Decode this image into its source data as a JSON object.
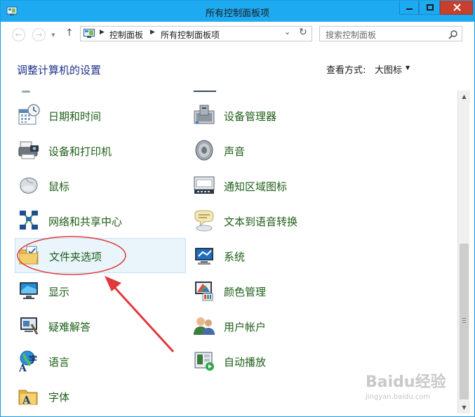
{
  "window": {
    "title": "所有控制面板项"
  },
  "nav": {
    "back_icon": "back-arrow-icon",
    "forward_icon": "forward-arrow-icon",
    "up_icon": "up-arrow-icon",
    "breadcrumbs": [
      "控制面板",
      "所有控制面板项"
    ],
    "search_placeholder": "搜索控制面板"
  },
  "header": {
    "title": "调整计算机的设置",
    "view_by_label": "查看方式:",
    "view_by_value": "大图标"
  },
  "items_left": [
    {
      "label": "日期和时间",
      "icon": "calendar-clock-icon"
    },
    {
      "label": "设备和打印机",
      "icon": "printer-camera-icon"
    },
    {
      "label": "鼠标",
      "icon": "mouse-icon"
    },
    {
      "label": "网络和共享中心",
      "icon": "network-icon"
    },
    {
      "label": "文件夹选项",
      "icon": "folder-options-icon",
      "selected": true
    },
    {
      "label": "显示",
      "icon": "monitor-icon"
    },
    {
      "label": "疑难解答",
      "icon": "troubleshoot-icon"
    },
    {
      "label": "语言",
      "icon": "language-globe-icon"
    },
    {
      "label": "字体",
      "icon": "font-folder-icon"
    }
  ],
  "items_right": [
    {
      "label": "设备管理器",
      "icon": "device-manager-icon"
    },
    {
      "label": "声音",
      "icon": "speaker-icon"
    },
    {
      "label": "通知区域图标",
      "icon": "notification-area-icon"
    },
    {
      "label": "文本到语音转换",
      "icon": "speech-bubble-icon"
    },
    {
      "label": "系统",
      "icon": "system-icon"
    },
    {
      "label": "颜色管理",
      "icon": "color-management-icon"
    },
    {
      "label": "用户帐户",
      "icon": "user-accounts-icon"
    },
    {
      "label": "自动播放",
      "icon": "autoplay-icon"
    }
  ],
  "watermark": {
    "text": "Baidu经验",
    "sub": "jingyan.baidu.com"
  },
  "colors": {
    "titlebar": "#1eaaf1",
    "close_button": "#c7402d",
    "item_label": "#1f5f18",
    "heading": "#1e3287",
    "annotation": "#e0383c"
  }
}
